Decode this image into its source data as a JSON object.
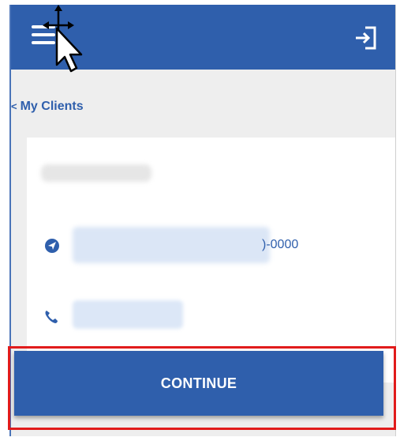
{
  "header": {
    "menu_icon": "hamburger-menu-icon",
    "logout_icon": "logout-icon",
    "color": "#2f5fac"
  },
  "nav": {
    "back_label": "My Clients",
    "back_chevron": "<"
  },
  "client_card": {
    "address_tail": ")-0000",
    "address_icon": "location-arrow-icon",
    "phone_icon": "phone-icon"
  },
  "actions": {
    "continue_label": "CONTINUE",
    "highlight_color": "#e11b1b"
  }
}
